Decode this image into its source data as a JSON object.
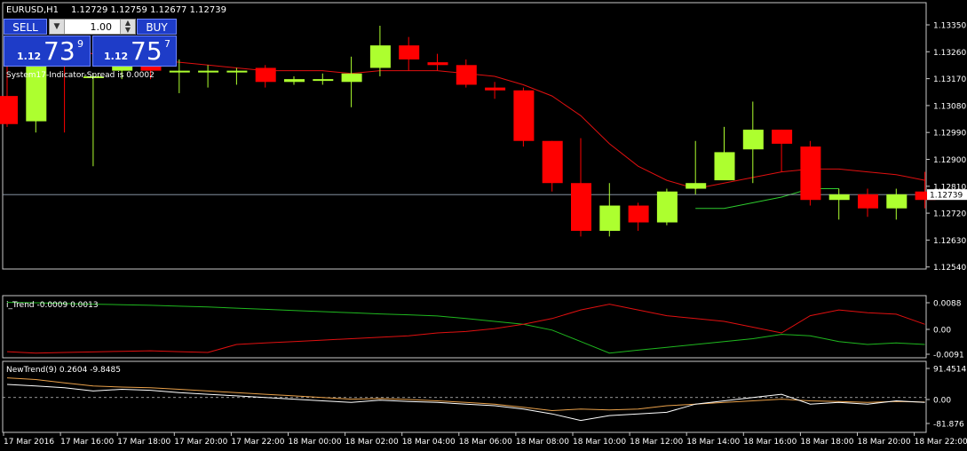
{
  "header": {
    "symbol": "EURUSD,H1",
    "ohlc": "1.12729 1.12759 1.12677 1.12739"
  },
  "trade_panel": {
    "sell_label": "SELL",
    "buy_label": "BUY",
    "lot_value": "1.00",
    "sell_prefix": "1.12",
    "sell_big": "73",
    "sell_sup": "9",
    "buy_prefix": "1.12",
    "buy_big": "75",
    "buy_sup": "7"
  },
  "indicator_note": "System17-Indicator-Spread is 0.0002",
  "price_axis": {
    "labels": [
      "1.13350",
      "1.13260",
      "1.13170",
      "1.13080",
      "1.12990",
      "1.12900",
      "1.12810",
      "1.12720",
      "1.12630",
      "1.12540"
    ],
    "current_price": "1.12739"
  },
  "sub1": {
    "title": "i_Trend -0.0009 0.0013",
    "labels": [
      "0.0088",
      "0.00",
      "-0.0091"
    ]
  },
  "sub2": {
    "title": "NewTrend(9) 0.2604 -9.8485",
    "labels": [
      "91.4514",
      "0.00",
      "-81.876"
    ]
  },
  "time_axis": [
    "17 Mar 2016",
    "17 Mar 16:00",
    "17 Mar 18:00",
    "17 Mar 20:00",
    "17 Mar 22:00",
    "18 Mar 00:00",
    "18 Mar 02:00",
    "18 Mar 04:00",
    "18 Mar 06:00",
    "18 Mar 08:00",
    "18 Mar 10:00",
    "18 Mar 12:00",
    "18 Mar 14:00",
    "18 Mar 16:00",
    "18 Mar 18:00",
    "18 Mar 20:00",
    "18 Mar 22:00"
  ],
  "colors": {
    "bull": "#adff2f",
    "bear": "#ff0000",
    "grid": "#c8c8c8",
    "panel": "#1e3cc8"
  },
  "chart_data": {
    "type": "candlestick",
    "ylim": [
      1.1249,
      1.134
    ],
    "candles": [
      {
        "o": 1.1309,
        "h": 1.1324,
        "l": 1.1298,
        "c": 1.1299
      },
      {
        "o": 1.13,
        "h": 1.1323,
        "l": 1.1296,
        "c": 1.1323
      },
      {
        "o": 1.1324,
        "h": 1.1325,
        "l": 1.1296,
        "c": 1.132
      },
      {
        "o": 1.1316,
        "h": 1.1317,
        "l": 1.1284,
        "c": 1.1316
      },
      {
        "o": 1.1318,
        "h": 1.1326,
        "l": 1.1315,
        "c": 1.1322
      },
      {
        "o": 1.132,
        "h": 1.1322,
        "l": 1.1315,
        "c": 1.1318
      },
      {
        "o": 1.1318,
        "h": 1.1322,
        "l": 1.131,
        "c": 1.1318
      },
      {
        "o": 1.1318,
        "h": 1.132,
        "l": 1.1312,
        "c": 1.1318
      },
      {
        "o": 1.1318,
        "h": 1.1319,
        "l": 1.1313,
        "c": 1.1318
      },
      {
        "o": 1.1319,
        "h": 1.132,
        "l": 1.1312,
        "c": 1.1314
      },
      {
        "o": 1.1314,
        "h": 1.1316,
        "l": 1.1313,
        "c": 1.1315
      },
      {
        "o": 1.1315,
        "h": 1.1317,
        "l": 1.1313,
        "c": 1.1315
      },
      {
        "o": 1.1314,
        "h": 1.1323,
        "l": 1.1305,
        "c": 1.1317
      },
      {
        "o": 1.1319,
        "h": 1.1334,
        "l": 1.1316,
        "c": 1.1327
      },
      {
        "o": 1.1327,
        "h": 1.133,
        "l": 1.1318,
        "c": 1.1322
      },
      {
        "o": 1.1321,
        "h": 1.1324,
        "l": 1.1318,
        "c": 1.132
      },
      {
        "o": 1.132,
        "h": 1.1322,
        "l": 1.1312,
        "c": 1.1313
      },
      {
        "o": 1.1312,
        "h": 1.1314,
        "l": 1.1308,
        "c": 1.1311
      },
      {
        "o": 1.1311,
        "h": 1.1312,
        "l": 1.1291,
        "c": 1.1293
      },
      {
        "o": 1.1293,
        "h": 1.1293,
        "l": 1.1275,
        "c": 1.1278
      },
      {
        "o": 1.1278,
        "h": 1.1294,
        "l": 1.1259,
        "c": 1.1261
      },
      {
        "o": 1.1261,
        "h": 1.1278,
        "l": 1.1259,
        "c": 1.127
      },
      {
        "o": 1.127,
        "h": 1.1271,
        "l": 1.1261,
        "c": 1.1264
      },
      {
        "o": 1.1264,
        "h": 1.1276,
        "l": 1.1263,
        "c": 1.1275
      },
      {
        "o": 1.1276,
        "h": 1.1293,
        "l": 1.1274,
        "c": 1.1278
      },
      {
        "o": 1.1279,
        "h": 1.1298,
        "l": 1.1279,
        "c": 1.1289
      },
      {
        "o": 1.129,
        "h": 1.1307,
        "l": 1.1278,
        "c": 1.1297
      },
      {
        "o": 1.1297,
        "h": 1.1297,
        "l": 1.1282,
        "c": 1.1292
      },
      {
        "o": 1.1291,
        "h": 1.1293,
        "l": 1.127,
        "c": 1.1272
      },
      {
        "o": 1.1272,
        "h": 1.1276,
        "l": 1.1265,
        "c": 1.1274
      },
      {
        "o": 1.1274,
        "h": 1.1276,
        "l": 1.1266,
        "c": 1.1269
      },
      {
        "o": 1.1269,
        "h": 1.1276,
        "l": 1.1265,
        "c": 1.1274
      },
      {
        "o": 1.1275,
        "h": 1.1282,
        "l": 1.1269,
        "c": 1.1272
      }
    ],
    "ma": [
      1.133,
      1.1328,
      1.1326,
      1.1324,
      1.1323,
      1.1322,
      1.1321,
      1.132,
      1.1319,
      1.1318,
      1.1318,
      1.1318,
      1.1317,
      1.1318,
      1.1318,
      1.1318,
      1.1317,
      1.1316,
      1.1313,
      1.1309,
      1.1302,
      1.1292,
      1.1284,
      1.1279,
      1.1276,
      1.1278,
      1.128,
      1.1282,
      1.1283,
      1.1283,
      1.1282,
      1.1281,
      1.1279
    ],
    "ma2": [
      null,
      null,
      null,
      null,
      null,
      null,
      null,
      null,
      null,
      null,
      null,
      null,
      null,
      null,
      null,
      null,
      null,
      null,
      null,
      null,
      null,
      null,
      null,
      null,
      1.1269,
      1.1269,
      1.1271,
      1.1273,
      1.1276,
      1.1276,
      null,
      null,
      null
    ],
    "i_trend_green": [
      0.0086,
      0.0085,
      0.0082,
      0.008,
      0.0078,
      0.0076,
      0.0073,
      0.007,
      0.0066,
      0.0062,
      0.0058,
      0.0054,
      0.005,
      0.0046,
      0.0043,
      0.0039,
      0.003,
      0.002,
      0.001,
      -0.001,
      -0.005,
      -0.009,
      -0.008,
      -0.007,
      -0.006,
      -0.005,
      -0.004,
      -0.0025,
      -0.003,
      -0.005,
      -0.006,
      -0.0055,
      -0.006
    ],
    "i_trend_red": [
      -0.0085,
      -0.009,
      -0.0088,
      -0.0086,
      -0.0084,
      -0.0082,
      -0.0085,
      -0.0088,
      -0.006,
      -0.0055,
      -0.005,
      -0.0045,
      -0.004,
      -0.0035,
      -0.003,
      -0.002,
      -0.0015,
      -0.0005,
      0.001,
      0.003,
      0.006,
      0.008,
      0.006,
      0.004,
      0.003,
      0.002,
      0.0,
      -0.002,
      0.004,
      0.006,
      0.005,
      0.0045,
      0.001
    ],
    "newtrend_white": [
      40,
      35,
      30,
      20,
      25,
      22,
      15,
      10,
      5,
      0,
      -5,
      -10,
      -15,
      -8,
      -12,
      -15,
      -20,
      -25,
      -35,
      -50,
      -70,
      -55,
      -50,
      -45,
      -20,
      -10,
      0,
      10,
      -20,
      -15,
      -20,
      -10,
      -15
    ],
    "newtrend_orange": [
      60,
      55,
      45,
      35,
      32,
      30,
      25,
      20,
      15,
      10,
      5,
      0,
      -5,
      -3,
      -6,
      -10,
      -15,
      -20,
      -30,
      -40,
      -35,
      -38,
      -35,
      -25,
      -20,
      -15,
      -10,
      -5,
      -10,
      -12,
      -15,
      -12,
      -14
    ]
  }
}
